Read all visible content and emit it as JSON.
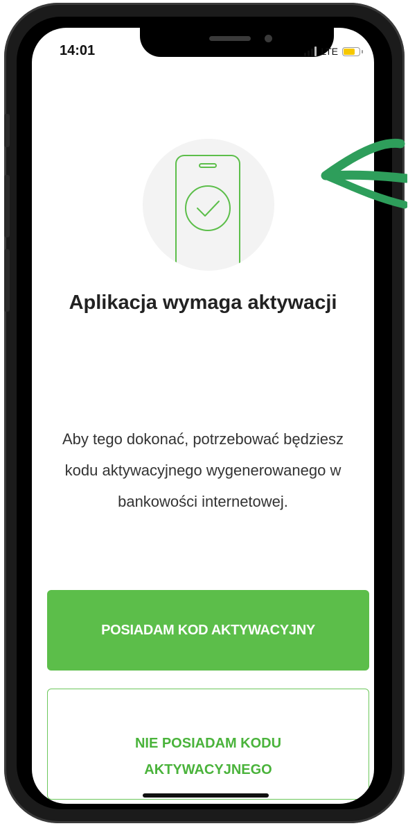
{
  "status_bar": {
    "time": "14:01",
    "network": "LTE",
    "battery_color": "#f6c800"
  },
  "illustration": {
    "icon": "phone-check-icon",
    "accent": "#5cbe4a"
  },
  "title": "Aplikacja wymaga aktywacji",
  "description": "Aby tego dokonać, potrzebować będziesz kodu aktywacyjnego wygenerowanego w bankowości internetowej.",
  "buttons": {
    "primary": "POSIADAM KOD AKTYWACYJNY",
    "secondary": "NIE POSIADAM KODU\nAKTYWACYJNEGO"
  },
  "colors": {
    "primary": "#5cbe4a",
    "secondary_text": "#4ab33b",
    "annotation": "#2e9e5b"
  }
}
